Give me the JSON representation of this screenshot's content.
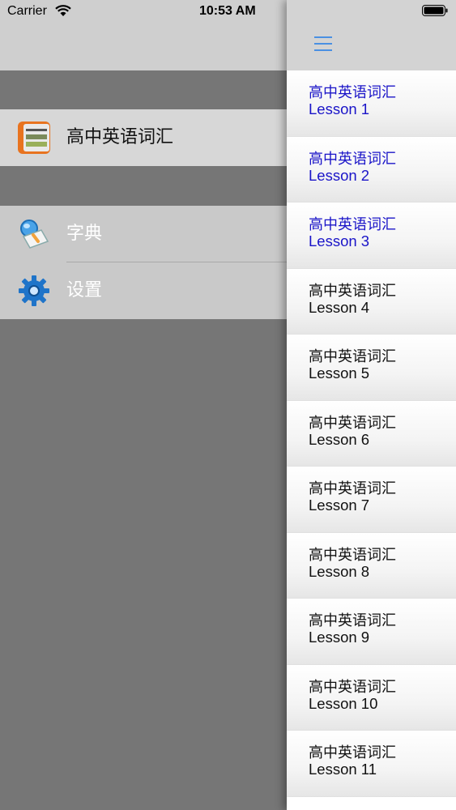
{
  "status_bar": {
    "carrier": "Carrier",
    "time": "10:53 AM"
  },
  "drawer": {
    "app_item": {
      "label": "高中英语词汇"
    },
    "items": [
      {
        "label": "字典",
        "icon": "dictionary-icon"
      },
      {
        "label": "设置",
        "icon": "gear-icon"
      }
    ]
  },
  "lessons": [
    {
      "title": "高中英语词汇",
      "subtitle": "Lesson 1",
      "visited": true
    },
    {
      "title": "高中英语词汇",
      "subtitle": "Lesson 2",
      "visited": true
    },
    {
      "title": "高中英语词汇",
      "subtitle": "Lesson 3",
      "visited": true
    },
    {
      "title": "高中英语词汇",
      "subtitle": "Lesson 4",
      "visited": false
    },
    {
      "title": "高中英语词汇",
      "subtitle": "Lesson 5",
      "visited": false
    },
    {
      "title": "高中英语词汇",
      "subtitle": "Lesson 6",
      "visited": false
    },
    {
      "title": "高中英语词汇",
      "subtitle": "Lesson 7",
      "visited": false
    },
    {
      "title": "高中英语词汇",
      "subtitle": "Lesson 8",
      "visited": false
    },
    {
      "title": "高中英语词汇",
      "subtitle": "Lesson 9",
      "visited": false
    },
    {
      "title": "高中英语词汇",
      "subtitle": "Lesson 10",
      "visited": false
    },
    {
      "title": "高中英语词汇",
      "subtitle": "Lesson 11",
      "visited": false
    }
  ],
  "colors": {
    "visited_link": "#1a14c8",
    "accent": "#4a90e2"
  }
}
